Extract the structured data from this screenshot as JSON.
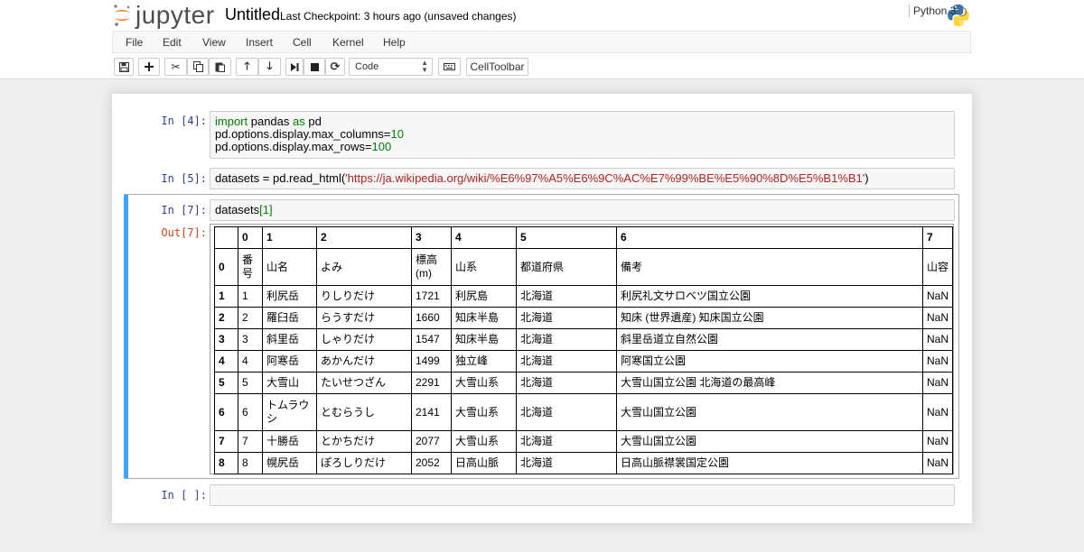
{
  "header": {
    "logo_text": "jupyter",
    "notebook_name": "Untitled",
    "checkpoint": "Last Checkpoint: 3 hours ago (unsaved changes)"
  },
  "menu": {
    "items": [
      "File",
      "Edit",
      "View",
      "Insert",
      "Cell",
      "Kernel",
      "Help"
    ],
    "kernel_name": "Python 3"
  },
  "toolbar": {
    "cell_type": "Code",
    "celltoolbar_label": "CellToolbar",
    "icons": [
      "save-icon",
      "plus-icon",
      "cut-icon",
      "copy-icon",
      "paste-icon",
      "arrow-up-icon",
      "arrow-down-icon",
      "step-forward-icon",
      "stop-icon",
      "restart-icon",
      "keyboard-icon"
    ]
  },
  "cells": {
    "c1": {
      "prompt": "In [4]:",
      "line1_kw1": "import",
      "line1_mid": " pandas ",
      "line1_kw2": "as",
      "line1_end": " pd",
      "line2_code": "pd.options.display.max_columns=",
      "line2_num": "10",
      "line3_code": "pd.options.display.max_rows=",
      "line3_num": "100"
    },
    "c2": {
      "prompt": "In [5]:",
      "code_start": "datasets = pd.read_html(",
      "code_str": "'https://ja.wikipedia.org/wiki/%E6%97%A5%E6%9C%AC%E7%99%BE%E5%90%8D%E5%B1%B1'",
      "code_end": ")"
    },
    "c3": {
      "prompt": "In [7]:",
      "code": "datasets",
      "bracket": "[1]",
      "out_prompt": "Out[7]:"
    },
    "c4": {
      "prompt": "In [ ]:"
    }
  },
  "table": {
    "columns": [
      "",
      "0",
      "1",
      "2",
      "3",
      "4",
      "5",
      "6",
      "7"
    ],
    "rows": [
      [
        "0",
        "番号",
        "山名",
        "よみ",
        "標高(m)",
        "山系",
        "都道府県",
        "備考",
        "山容"
      ],
      [
        "1",
        "1",
        "利尻岳",
        "りしりだけ",
        "1721",
        "利尻島",
        "北海道",
        "利尻礼文サロベツ国立公園",
        "NaN"
      ],
      [
        "2",
        "2",
        "羅臼岳",
        "らうすだけ",
        "1660",
        "知床半島",
        "北海道",
        "知床 (世界遺産) 知床国立公園",
        "NaN"
      ],
      [
        "3",
        "3",
        "斜里岳",
        "しゃりだけ",
        "1547",
        "知床半島",
        "北海道",
        "斜里岳道立自然公園",
        "NaN"
      ],
      [
        "4",
        "4",
        "阿寒岳",
        "あかんだけ",
        "1499",
        "独立峰",
        "北海道",
        "阿寒国立公園",
        "NaN"
      ],
      [
        "5",
        "5",
        "大雪山",
        "たいせつざん",
        "2291",
        "大雪山系",
        "北海道",
        "大雪山国立公園 北海道の最高峰",
        "NaN"
      ],
      [
        "6",
        "6",
        "トムラウシ",
        "とむらうし",
        "2141",
        "大雪山系",
        "北海道",
        "大雪山国立公園",
        "NaN"
      ],
      [
        "7",
        "7",
        "十勝岳",
        "とかちだけ",
        "2077",
        "大雪山系",
        "北海道",
        "大雪山国立公園",
        "NaN"
      ],
      [
        "8",
        "8",
        "幌尻岳",
        "ぽろしりだけ",
        "2052",
        "日高山脈",
        "北海道",
        "日高山脈襟裳国定公園",
        "NaN"
      ]
    ]
  }
}
